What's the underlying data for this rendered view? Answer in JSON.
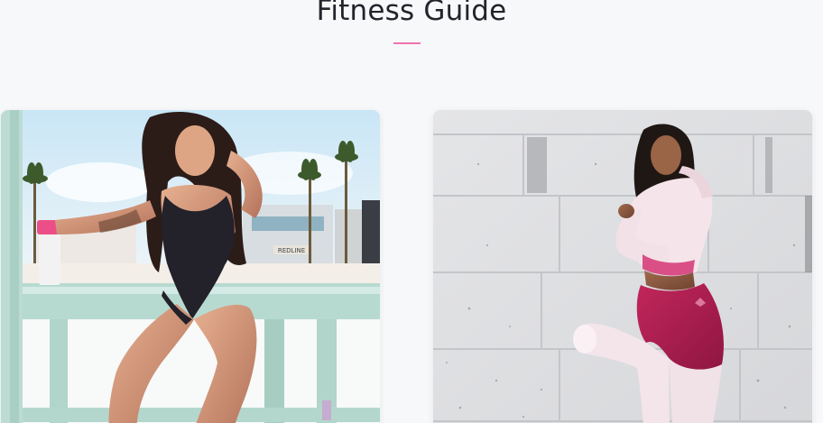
{
  "section": {
    "title": "Fitness Guide"
  },
  "colors": {
    "background": "#f7f8fa",
    "title_text": "#23232b",
    "accent_underline": "#ee74b0"
  },
  "cards": [
    {
      "image_label": "fitness-guide-card-beach",
      "sign_text": "REDLINE"
    },
    {
      "image_label": "fitness-guide-card-concrete",
      "sign_text": ""
    }
  ]
}
